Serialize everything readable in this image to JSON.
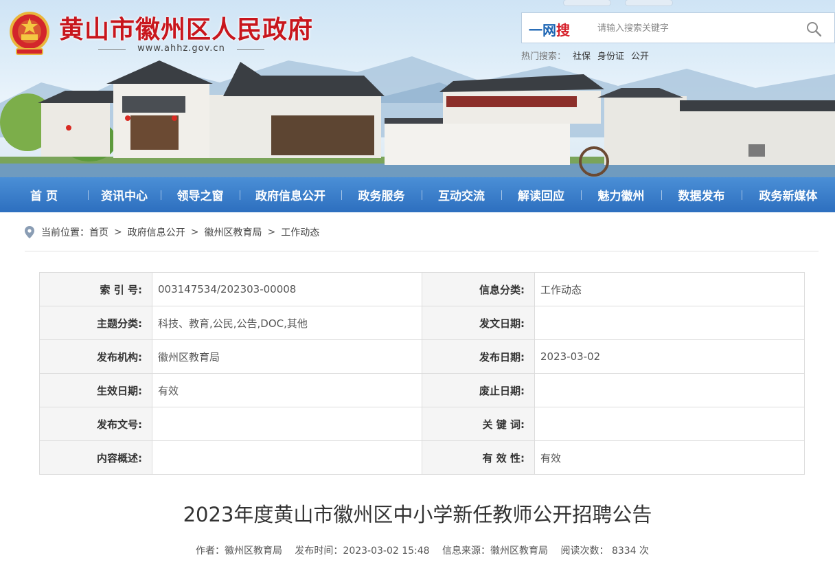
{
  "header": {
    "site_title": "黄山市徽州区人民政府",
    "site_url": "www.ahhz.gov.cn",
    "emblem_icon": "national-emblem-icon"
  },
  "search": {
    "brand_blue": "一网",
    "brand_red": "搜",
    "placeholder": "请输入搜索关键字",
    "hot_label": "热门搜索：",
    "hot_terms": [
      "社保",
      "身份证",
      "公开"
    ]
  },
  "nav": {
    "items": [
      "首 页",
      "资讯中心",
      "领导之窗",
      "政府信息公开",
      "政务服务",
      "互动交流",
      "解读回应",
      "魅力徽州",
      "数据发布",
      "政务新媒体"
    ]
  },
  "breadcrumb": {
    "label": "当前位置：",
    "items": [
      "首页",
      "政府信息公开",
      "徽州区教育局",
      "工作动态"
    ],
    "separator": ">"
  },
  "info_table": {
    "rows": [
      {
        "k1": "索 引 号:",
        "v1": "003147534/202303-00008",
        "k2": "信息分类:",
        "v2": "工作动态"
      },
      {
        "k1": "主题分类:",
        "v1": "科技、教育,公民,公告,DOC,其他",
        "k2": "发文日期:",
        "v2": ""
      },
      {
        "k1": "发布机构:",
        "v1": "徽州区教育局",
        "k2": "发布日期:",
        "v2": "2023-03-02"
      },
      {
        "k1": "生效日期:",
        "v1": "有效",
        "k2": "废止日期:",
        "v2": ""
      },
      {
        "k1": "发布文号:",
        "v1": "",
        "k2": "关 键 词:",
        "v2": ""
      },
      {
        "k1": "内容概述:",
        "v1": "",
        "k2": "有 效 性:",
        "v2": "有效"
      }
    ]
  },
  "article": {
    "title": "2023年度黄山市徽州区中小学新任教师公开招聘公告",
    "author": "作者：徽州区教育局",
    "publish_time": "发布时间：2023-03-02 15:48",
    "source": "信息来源：徽州区教育局",
    "views": "阅读次数：  8334 次"
  },
  "colors": {
    "brand_red": "#c8161d",
    "nav_blue": "#2d6fbf",
    "search_blue": "#1b64b3"
  }
}
